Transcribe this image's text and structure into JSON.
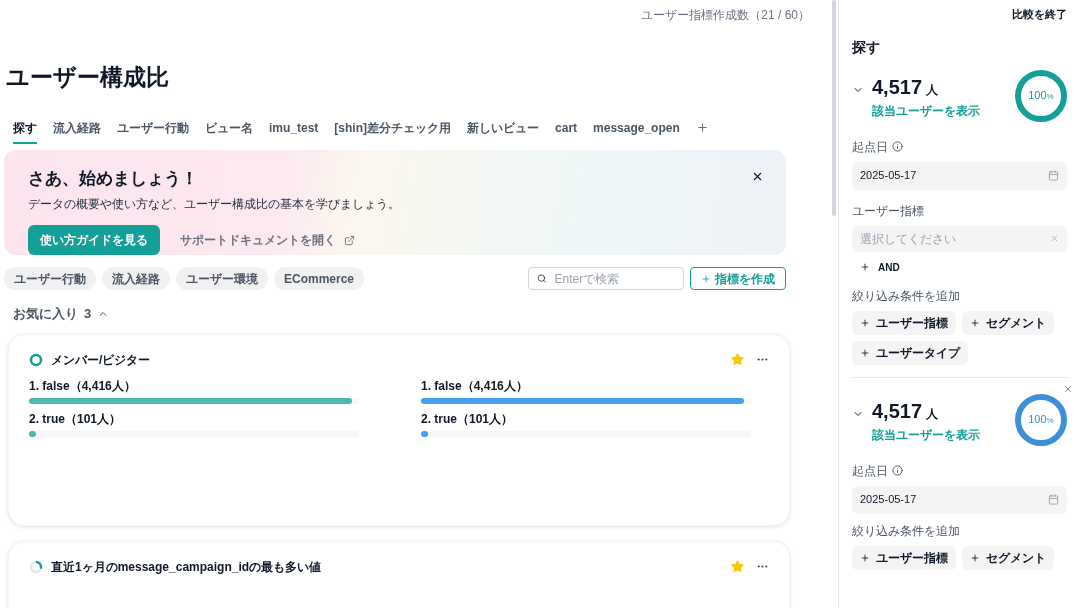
{
  "header": {
    "quota": "ユーザー指標作成数（21 / 60）"
  },
  "page_title": "ユーザー構成比",
  "tabs": [
    {
      "label": "探す",
      "selected": true
    },
    {
      "label": "流入経路",
      "selected": false
    },
    {
      "label": "ユーザー行動",
      "selected": false
    },
    {
      "label": "ビュー名",
      "selected": false
    },
    {
      "label": "imu_test",
      "selected": false
    },
    {
      "label": "[shin]差分チェック用",
      "selected": false
    },
    {
      "label": "新しいビュー",
      "selected": false
    },
    {
      "label": "cart",
      "selected": false
    },
    {
      "label": "message_open",
      "selected": false
    }
  ],
  "banner": {
    "title": "さあ、始めましょう！",
    "text": "データの概要や使い方など、ユーザー構成比の基本を学びましょう。",
    "primary_button": "使い方ガイドを見る",
    "link": "サポートドキュメントを開く"
  },
  "categories": [
    "ユーザー行動",
    "流入経路",
    "ユーザー環境",
    "ECommerce"
  ],
  "search": {
    "placeholder": "Enterで検索"
  },
  "create_button": "指標を作成",
  "favorites": {
    "label": "お気に入り",
    "count": "3",
    "expanded": true
  },
  "cards": [
    {
      "title": "メンバー/ビジター",
      "loaded": true,
      "starred": true,
      "columns": [
        {
          "color": "#4cb8b2",
          "rows": [
            {
              "label": "1. false（4,416人）",
              "level": 0.978
            },
            {
              "label": "2. true（101人）",
              "level": 0.022
            }
          ]
        },
        {
          "color": "#46a0f0",
          "rows": [
            {
              "label": "1. false（4,416人）",
              "level": 0.978
            },
            {
              "label": "2. true（101人）",
              "level": 0.022
            }
          ]
        }
      ]
    },
    {
      "title": "直近1ヶ月のmessage_campaign_idの最も多い値",
      "loaded": false,
      "starred": true
    }
  ],
  "sidebar": {
    "end_button": "比較を終了",
    "title": "探す",
    "segments": [
      {
        "count": "4,517",
        "unit": "人",
        "link": "該当ユーザーを表示",
        "percent": "100",
        "percent_unit": "%",
        "color": "#14a098",
        "closable": false,
        "date_label": "起点日",
        "date": "2025-05-17",
        "metric_label": "ユーザー指標",
        "metric_placeholder": "選択してください",
        "and_button": "AND",
        "filter_label": "絞り込み条件を追加",
        "filters": [
          "ユーザー指標",
          "セグメント",
          "ユーザータイプ"
        ]
      },
      {
        "count": "4,517",
        "unit": "人",
        "link": "該当ユーザーを表示",
        "percent": "100",
        "percent_unit": "%",
        "color": "#3d8fd8",
        "closable": true,
        "date_label": "起点日",
        "date": "2025-05-17",
        "filter_label": "絞り込み条件を追加",
        "filters": [
          "ユーザー指標",
          "セグメント"
        ]
      }
    ]
  }
}
